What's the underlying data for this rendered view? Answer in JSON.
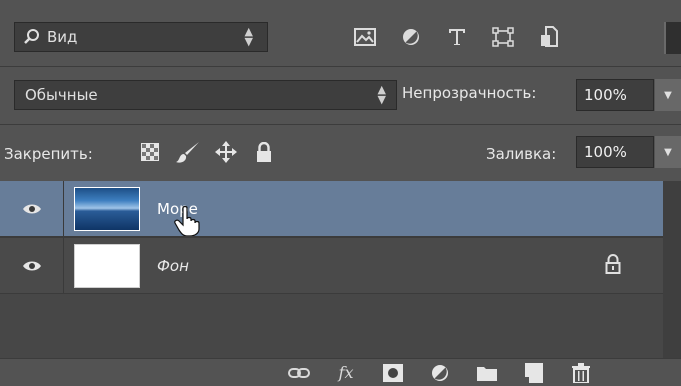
{
  "filter": {
    "kind_label": "Вид",
    "icons": [
      "image-filter-icon",
      "adjustment-filter-icon",
      "type-filter-icon",
      "shape-filter-icon",
      "smart-object-filter-icon"
    ]
  },
  "blend": {
    "mode": "Обычные",
    "opacity_label": "Непрозрачность:",
    "opacity_value": "100%"
  },
  "lock": {
    "label": "Закрепить:",
    "fill_label": "Заливка:",
    "fill_value": "100%"
  },
  "layers": [
    {
      "name": "Море",
      "visible": true,
      "selected": true
    },
    {
      "name": "Фон",
      "visible": true,
      "selected": false,
      "locked": true
    }
  ],
  "bottom_icons": [
    "link-icon",
    "fx-icon",
    "mask-icon",
    "adjustment-layer-icon",
    "group-folder-icon",
    "new-layer-icon",
    "trash-icon"
  ],
  "colors": {
    "panel": "#535353",
    "selected_layer": "#677d99",
    "field": "#3e3e3e"
  }
}
